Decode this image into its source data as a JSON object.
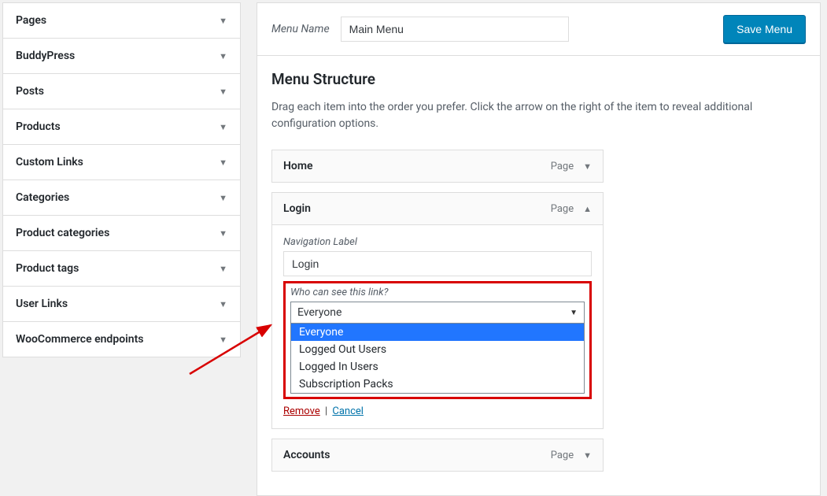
{
  "sidebar": {
    "items": [
      {
        "label": "Pages"
      },
      {
        "label": "BuddyPress"
      },
      {
        "label": "Posts"
      },
      {
        "label": "Products"
      },
      {
        "label": "Custom Links"
      },
      {
        "label": "Categories"
      },
      {
        "label": "Product categories"
      },
      {
        "label": "Product tags"
      },
      {
        "label": "User Links"
      },
      {
        "label": "WooCommerce endpoints"
      }
    ]
  },
  "header": {
    "menu_name_label": "Menu Name",
    "menu_name_value": "Main Menu",
    "save_label": "Save Menu"
  },
  "structure": {
    "title": "Menu Structure",
    "description": "Drag each item into the order you prefer. Click the arrow on the right of the item to reveal additional configuration options."
  },
  "menu_items": {
    "home": {
      "title": "Home",
      "type": "Page"
    },
    "login": {
      "title": "Login",
      "type": "Page",
      "nav_label_caption": "Navigation Label",
      "nav_label_value": "Login",
      "who_label": "Who can see this link?",
      "who_selected": "Everyone",
      "who_options": [
        "Everyone",
        "Logged Out Users",
        "Logged In Users",
        "Subscription Packs"
      ],
      "remove_label": "Remove",
      "cancel_label": "Cancel"
    },
    "accounts": {
      "title": "Accounts",
      "type": "Page"
    }
  }
}
